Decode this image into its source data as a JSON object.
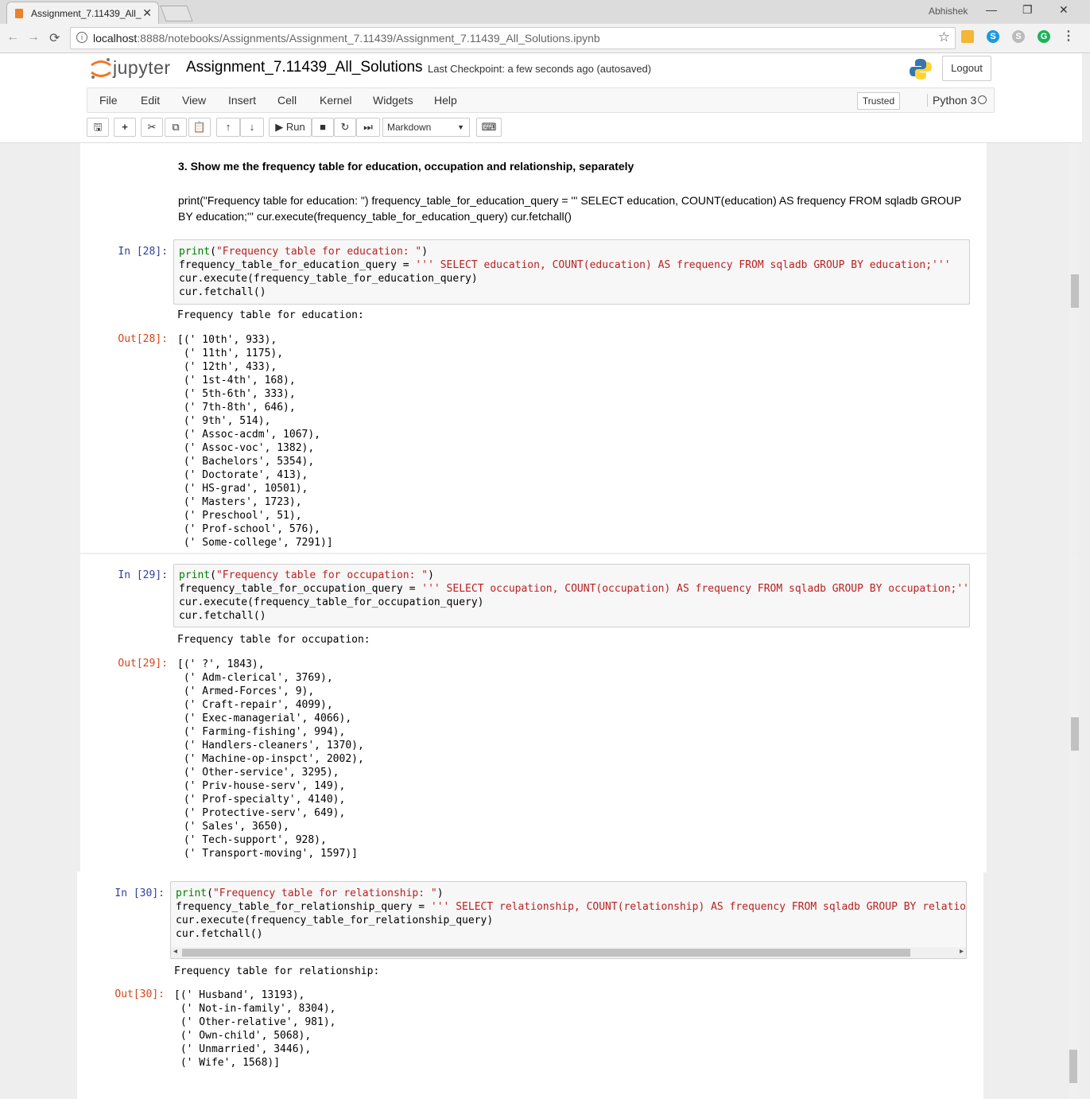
{
  "browser": {
    "tab_title": "Assignment_7.11439_All_",
    "user": "Abhishek",
    "url_host": "localhost",
    "url_path": ":8888/notebooks/Assignments/Assignment_7.11439/Assignment_7.11439_All_Solutions.ipynb",
    "info": "i",
    "close_tab": "✕",
    "win_min": "—",
    "win_max": "❐",
    "win_close": "✕",
    "back": "←",
    "forward": "→",
    "reload": "⟳",
    "star": "☆"
  },
  "jupyter": {
    "logo_text": "jupyter",
    "notebook_title": "Assignment_7.11439_All_Solutions",
    "checkpoint": "Last Checkpoint: a few seconds ago   (autosaved)",
    "logout": "Logout",
    "menu": [
      "File",
      "Edit",
      "View",
      "Insert",
      "Cell",
      "Kernel",
      "Widgets",
      "Help"
    ],
    "trusted": "Trusted",
    "kernel": "Python 3",
    "toolbar": {
      "save": "🖫",
      "add": "+",
      "cut": "✂",
      "copy": "⧉",
      "paste": "📋",
      "up": "↑",
      "down": "↓",
      "run": "Run",
      "stop": "■",
      "restart": "↻",
      "fastforward": "⏭",
      "cell_type": "Markdown",
      "cell_type_arrow": "▼",
      "keyboard": "⌨"
    }
  },
  "cells": {
    "md_heading": "3. Show me the frequency table for education, occupation and relationship, separately",
    "md_text_1": "print(\"Frequency table for education: \") frequency_table_for_education_query = ''' SELECT education, COUNT(education) AS frequency FROM sqladb GROUP",
    "md_text_2": "BY education;''' cur.execute(frequency_table_for_education_query) cur.fetchall()",
    "c28": {
      "in_prompt": "In [28]:",
      "out_prompt": "Out[28]:",
      "code": [
        [
          "print",
          "(",
          "\"Frequency table for education: \"",
          ")"
        ],
        "frequency_table_for_education_query = ",
        "''' SELECT education, COUNT(education) AS frequency FROM sqladb GROUP BY education;'''",
        "cur.execute(frequency_table_for_education_query)",
        "cur.fetchall()"
      ],
      "stdout": "Frequency table for education:",
      "result": "[(' 10th', 933),\n (' 11th', 1175),\n (' 12th', 433),\n (' 1st-4th', 168),\n (' 5th-6th', 333),\n (' 7th-8th', 646),\n (' 9th', 514),\n (' Assoc-acdm', 1067),\n (' Assoc-voc', 1382),\n (' Bachelors', 5354),\n (' Doctorate', 413),\n (' HS-grad', 10501),\n (' Masters', 1723),\n (' Preschool', 51),\n (' Prof-school', 576),\n (' Some-college', 7291)]"
    },
    "c29": {
      "in_prompt": "In [29]:",
      "out_prompt": "Out[29]:",
      "code": [
        [
          "print",
          "(",
          "\"Frequency table for occupation: \"",
          ")"
        ],
        "frequency_table_for_occupation_query = ",
        "''' SELECT occupation, COUNT(occupation) AS frequency FROM sqladb GROUP BY occupation;'''",
        "cur.execute(frequency_table_for_occupation_query)",
        "cur.fetchall()"
      ],
      "stdout": "Frequency table for occupation:",
      "result": "[(' ?', 1843),\n (' Adm-clerical', 3769),\n (' Armed-Forces', 9),\n (' Craft-repair', 4099),\n (' Exec-managerial', 4066),\n (' Farming-fishing', 994),\n (' Handlers-cleaners', 1370),\n (' Machine-op-inspct', 2002),\n (' Other-service', 3295),\n (' Priv-house-serv', 149),\n (' Prof-specialty', 4140),\n (' Protective-serv', 649),\n (' Sales', 3650),\n (' Tech-support', 928),\n (' Transport-moving', 1597)]"
    },
    "c30": {
      "in_prompt": "In [30]:",
      "out_prompt": "Out[30]:",
      "code": [
        [
          "print",
          "(",
          "\"Frequency table for relationship: \"",
          ")"
        ],
        "frequency_table_for_relationship_query = ",
        "''' SELECT relationship, COUNT(relationship) AS frequency FROM sqladb GROUP BY relations",
        "cur.execute(frequency_table_for_relationship_query)",
        "cur.fetchall()"
      ],
      "stdout": "Frequency table for relationship:",
      "result": "[(' Husband', 13193),\n (' Not-in-family', 8304),\n (' Other-relative', 981),\n (' Own-child', 5068),\n (' Unmarried', 3446),\n (' Wife', 1568)]",
      "hscroll_left": "◂",
      "hscroll_right": "▸"
    }
  }
}
